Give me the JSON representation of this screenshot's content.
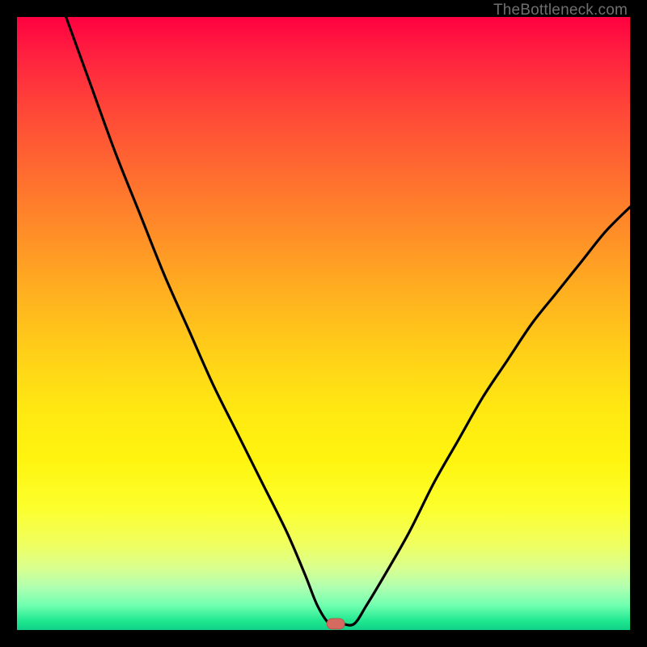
{
  "watermark": "TheBottleneck.com",
  "colors": {
    "frame": "#000000",
    "curve": "#000000",
    "marker_fill": "#d46a60",
    "marker_stroke": "#b5584f"
  },
  "chart_data": {
    "type": "line",
    "title": "",
    "xlabel": "",
    "ylabel": "",
    "xlim": [
      0,
      100
    ],
    "ylim": [
      0,
      100
    ],
    "marker": {
      "x": 52,
      "y": 1
    },
    "series": [
      {
        "name": "bottleneck-curve",
        "x": [
          8,
          12,
          16,
          20,
          24,
          28,
          32,
          36,
          40,
          44,
          47,
          49,
          51,
          53,
          55,
          57,
          60,
          64,
          68,
          72,
          76,
          80,
          84,
          88,
          92,
          96,
          100
        ],
        "y": [
          100,
          89,
          78,
          68,
          58,
          49,
          40,
          32,
          24,
          16,
          9,
          4,
          1,
          1,
          1,
          4,
          9,
          16,
          24,
          31,
          38,
          44,
          50,
          55,
          60,
          65,
          69
        ]
      }
    ],
    "annotations": []
  }
}
